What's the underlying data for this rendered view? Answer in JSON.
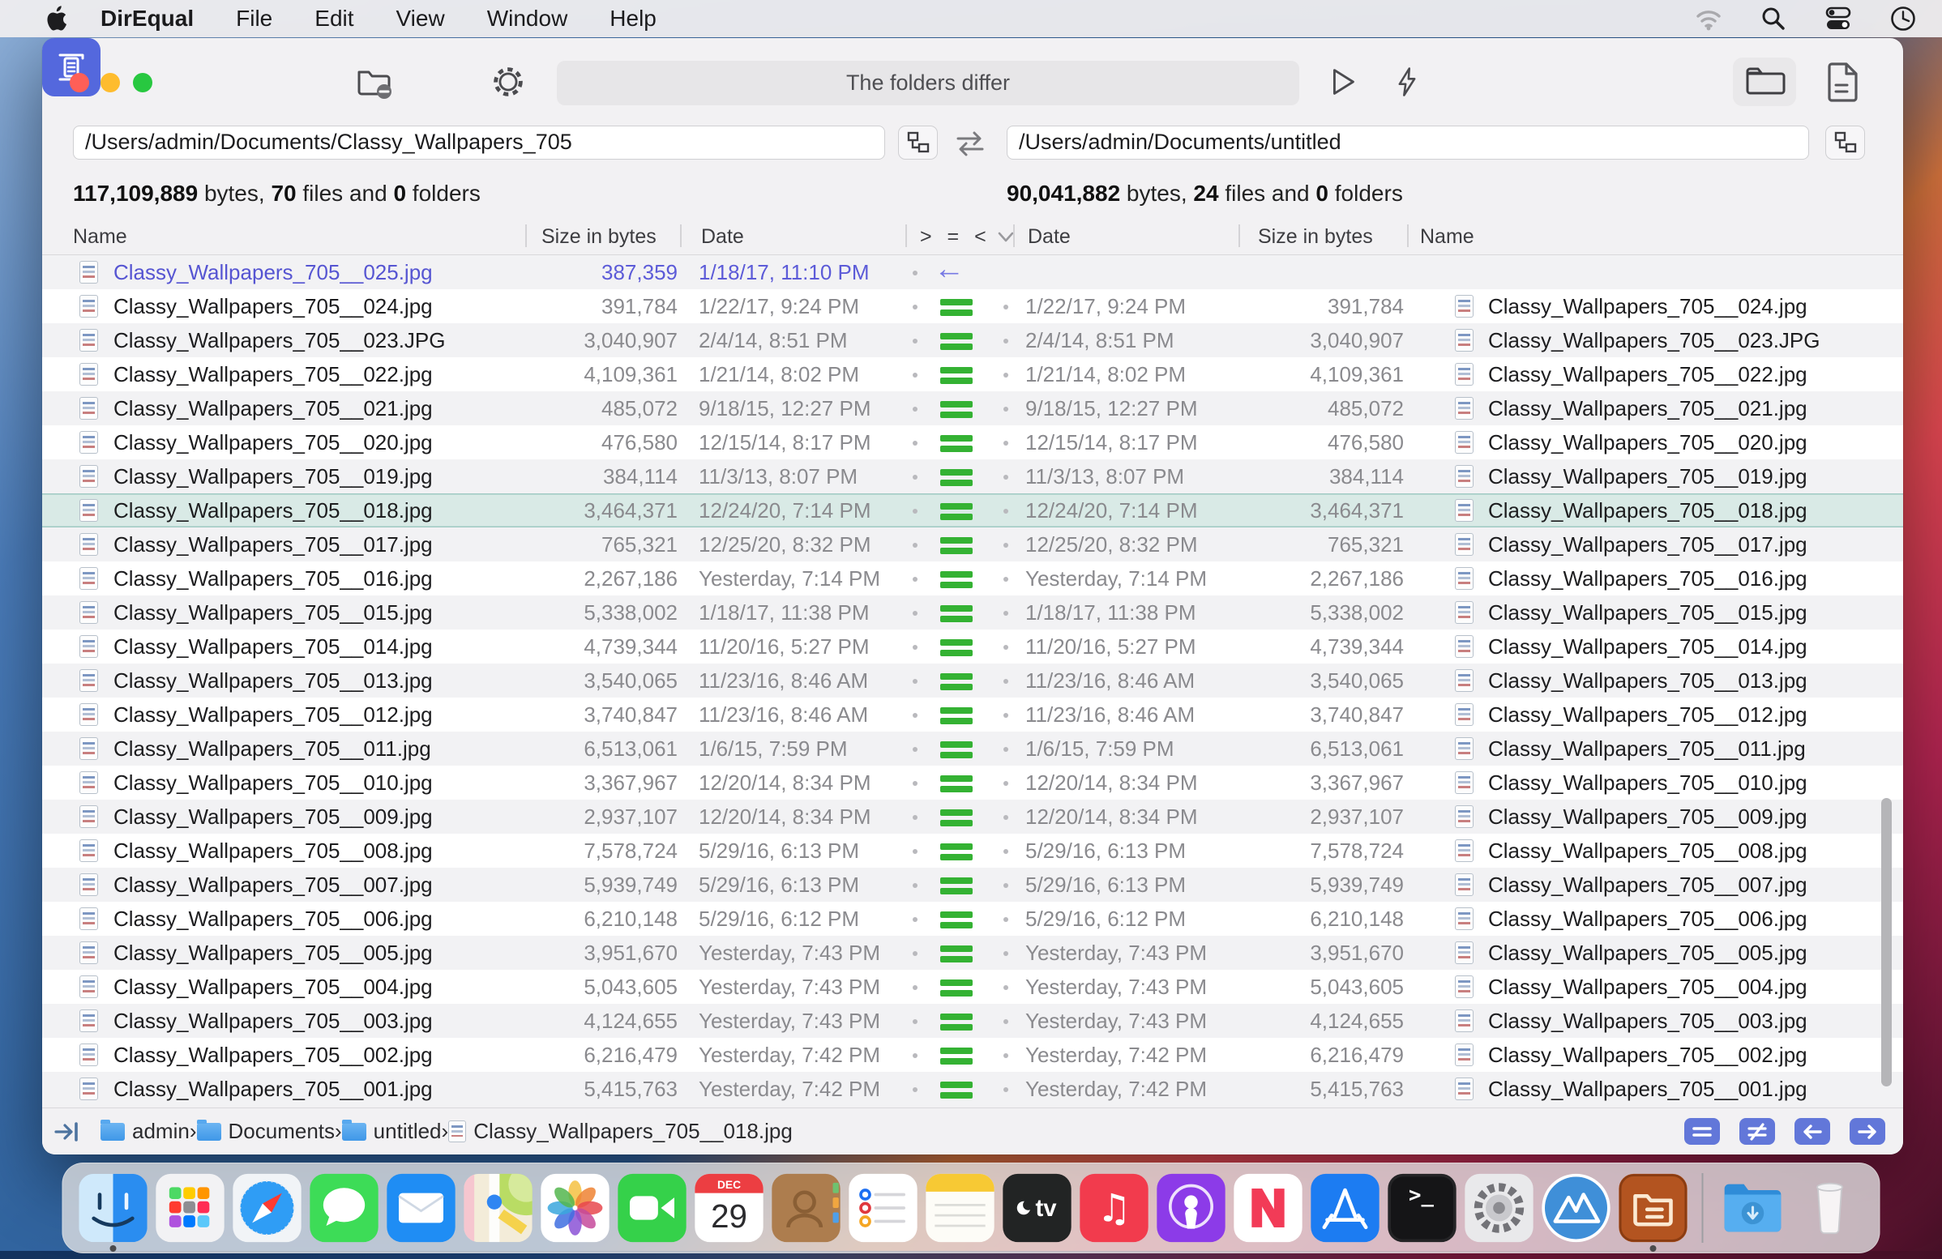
{
  "menu_bar": {
    "app_name": "DirEqual",
    "menus": [
      "File",
      "Edit",
      "View",
      "Window",
      "Help"
    ],
    "status_icons": [
      "wifi-icon",
      "search-icon",
      "control-center-icon",
      "clock-icon"
    ]
  },
  "toolbar": {
    "status_text": "The folders differ"
  },
  "panes": {
    "left": {
      "path": "/Users/admin/Documents/Classy_Wallpapers_705",
      "bytes": "117,109,889",
      "bytes_label": " bytes, ",
      "files": "70",
      "files_label": " files and ",
      "folders": "0",
      "folders_label": " folders"
    },
    "right": {
      "path": "/Users/admin/Documents/untitled",
      "bytes": "90,041,882",
      "bytes_label": " bytes, ",
      "files": "24",
      "files_label": " files and ",
      "folders": "0",
      "folders_label": " folders"
    }
  },
  "table": {
    "headers": {
      "name_left": "Name",
      "size_left": "Size in bytes",
      "date_left": "Date",
      "compare": "> = <",
      "date_right": "Date",
      "size_right": "Size in bytes",
      "name_right": "Name"
    },
    "rows": [
      {
        "left_name": "Classy_Wallpapers_705__025.jpg",
        "left_size": "387,359",
        "left_date": "1/18/17, 11:10 PM",
        "status": "left_only",
        "right_date": "",
        "right_size": "",
        "right_name": "",
        "selected": false
      },
      {
        "left_name": "Classy_Wallpapers_705__024.jpg",
        "left_size": "391,784",
        "left_date": "1/22/17, 9:24 PM",
        "status": "equal",
        "right_date": "1/22/17, 9:24 PM",
        "right_size": "391,784",
        "right_name": "Classy_Wallpapers_705__024.jpg",
        "selected": false
      },
      {
        "left_name": "Classy_Wallpapers_705__023.JPG",
        "left_size": "3,040,907",
        "left_date": "2/4/14, 8:51 PM",
        "status": "equal",
        "right_date": "2/4/14, 8:51 PM",
        "right_size": "3,040,907",
        "right_name": "Classy_Wallpapers_705__023.JPG",
        "selected": false
      },
      {
        "left_name": "Classy_Wallpapers_705__022.jpg",
        "left_size": "4,109,361",
        "left_date": "1/21/14, 8:02 PM",
        "status": "equal",
        "right_date": "1/21/14, 8:02 PM",
        "right_size": "4,109,361",
        "right_name": "Classy_Wallpapers_705__022.jpg",
        "selected": false
      },
      {
        "left_name": "Classy_Wallpapers_705__021.jpg",
        "left_size": "485,072",
        "left_date": "9/18/15, 12:27 PM",
        "status": "equal",
        "right_date": "9/18/15, 12:27 PM",
        "right_size": "485,072",
        "right_name": "Classy_Wallpapers_705__021.jpg",
        "selected": false
      },
      {
        "left_name": "Classy_Wallpapers_705__020.jpg",
        "left_size": "476,580",
        "left_date": "12/15/14, 8:17 PM",
        "status": "equal",
        "right_date": "12/15/14, 8:17 PM",
        "right_size": "476,580",
        "right_name": "Classy_Wallpapers_705__020.jpg",
        "selected": false
      },
      {
        "left_name": "Classy_Wallpapers_705__019.jpg",
        "left_size": "384,114",
        "left_date": "11/3/13, 8:07 PM",
        "status": "equal",
        "right_date": "11/3/13, 8:07 PM",
        "right_size": "384,114",
        "right_name": "Classy_Wallpapers_705__019.jpg",
        "selected": false
      },
      {
        "left_name": "Classy_Wallpapers_705__018.jpg",
        "left_size": "3,464,371",
        "left_date": "12/24/20, 7:14 PM",
        "status": "equal",
        "right_date": "12/24/20, 7:14 PM",
        "right_size": "3,464,371",
        "right_name": "Classy_Wallpapers_705__018.jpg",
        "selected": true
      },
      {
        "left_name": "Classy_Wallpapers_705__017.jpg",
        "left_size": "765,321",
        "left_date": "12/25/20, 8:32 PM",
        "status": "equal",
        "right_date": "12/25/20, 8:32 PM",
        "right_size": "765,321",
        "right_name": "Classy_Wallpapers_705__017.jpg",
        "selected": false
      },
      {
        "left_name": "Classy_Wallpapers_705__016.jpg",
        "left_size": "2,267,186",
        "left_date": "Yesterday, 7:14 PM",
        "status": "equal",
        "right_date": "Yesterday, 7:14 PM",
        "right_size": "2,267,186",
        "right_name": "Classy_Wallpapers_705__016.jpg",
        "selected": false
      },
      {
        "left_name": "Classy_Wallpapers_705__015.jpg",
        "left_size": "5,338,002",
        "left_date": "1/18/17, 11:38 PM",
        "status": "equal",
        "right_date": "1/18/17, 11:38 PM",
        "right_size": "5,338,002",
        "right_name": "Classy_Wallpapers_705__015.jpg",
        "selected": false
      },
      {
        "left_name": "Classy_Wallpapers_705__014.jpg",
        "left_size": "4,739,344",
        "left_date": "11/20/16, 5:27 PM",
        "status": "equal",
        "right_date": "11/20/16, 5:27 PM",
        "right_size": "4,739,344",
        "right_name": "Classy_Wallpapers_705__014.jpg",
        "selected": false
      },
      {
        "left_name": "Classy_Wallpapers_705__013.jpg",
        "left_size": "3,540,065",
        "left_date": "11/23/16, 8:46 AM",
        "status": "equal",
        "right_date": "11/23/16, 8:46 AM",
        "right_size": "3,540,065",
        "right_name": "Classy_Wallpapers_705__013.jpg",
        "selected": false
      },
      {
        "left_name": "Classy_Wallpapers_705__012.jpg",
        "left_size": "3,740,847",
        "left_date": "11/23/16, 8:46 AM",
        "status": "equal",
        "right_date": "11/23/16, 8:46 AM",
        "right_size": "3,740,847",
        "right_name": "Classy_Wallpapers_705__012.jpg",
        "selected": false
      },
      {
        "left_name": "Classy_Wallpapers_705__011.jpg",
        "left_size": "6,513,061",
        "left_date": "1/6/15, 7:59 PM",
        "status": "equal",
        "right_date": "1/6/15, 7:59 PM",
        "right_size": "6,513,061",
        "right_name": "Classy_Wallpapers_705__011.jpg",
        "selected": false
      },
      {
        "left_name": "Classy_Wallpapers_705__010.jpg",
        "left_size": "3,367,967",
        "left_date": "12/20/14, 8:34 PM",
        "status": "equal",
        "right_date": "12/20/14, 8:34 PM",
        "right_size": "3,367,967",
        "right_name": "Classy_Wallpapers_705__010.jpg",
        "selected": false
      },
      {
        "left_name": "Classy_Wallpapers_705__009.jpg",
        "left_size": "2,937,107",
        "left_date": "12/20/14, 8:34 PM",
        "status": "equal",
        "right_date": "12/20/14, 8:34 PM",
        "right_size": "2,937,107",
        "right_name": "Classy_Wallpapers_705__009.jpg",
        "selected": false
      },
      {
        "left_name": "Classy_Wallpapers_705__008.jpg",
        "left_size": "7,578,724",
        "left_date": "5/29/16, 6:13 PM",
        "status": "equal",
        "right_date": "5/29/16, 6:13 PM",
        "right_size": "7,578,724",
        "right_name": "Classy_Wallpapers_705__008.jpg",
        "selected": false
      },
      {
        "left_name": "Classy_Wallpapers_705__007.jpg",
        "left_size": "5,939,749",
        "left_date": "5/29/16, 6:13 PM",
        "status": "equal",
        "right_date": "5/29/16, 6:13 PM",
        "right_size": "5,939,749",
        "right_name": "Classy_Wallpapers_705__007.jpg",
        "selected": false
      },
      {
        "left_name": "Classy_Wallpapers_705__006.jpg",
        "left_size": "6,210,148",
        "left_date": "5/29/16, 6:12 PM",
        "status": "equal",
        "right_date": "5/29/16, 6:12 PM",
        "right_size": "6,210,148",
        "right_name": "Classy_Wallpapers_705__006.jpg",
        "selected": false
      },
      {
        "left_name": "Classy_Wallpapers_705__005.jpg",
        "left_size": "3,951,670",
        "left_date": "Yesterday, 7:43 PM",
        "status": "equal",
        "right_date": "Yesterday, 7:43 PM",
        "right_size": "3,951,670",
        "right_name": "Classy_Wallpapers_705__005.jpg",
        "selected": false
      },
      {
        "left_name": "Classy_Wallpapers_705__004.jpg",
        "left_size": "5,043,605",
        "left_date": "Yesterday, 7:43 PM",
        "status": "equal",
        "right_date": "Yesterday, 7:43 PM",
        "right_size": "5,043,605",
        "right_name": "Classy_Wallpapers_705__004.jpg",
        "selected": false
      },
      {
        "left_name": "Classy_Wallpapers_705__003.jpg",
        "left_size": "4,124,655",
        "left_date": "Yesterday, 7:43 PM",
        "status": "equal",
        "right_date": "Yesterday, 7:43 PM",
        "right_size": "4,124,655",
        "right_name": "Classy_Wallpapers_705__003.jpg",
        "selected": false
      },
      {
        "left_name": "Classy_Wallpapers_705__002.jpg",
        "left_size": "6,216,479",
        "left_date": "Yesterday, 7:42 PM",
        "status": "equal",
        "right_date": "Yesterday, 7:42 PM",
        "right_size": "6,216,479",
        "right_name": "Classy_Wallpapers_705__002.jpg",
        "selected": false
      },
      {
        "left_name": "Classy_Wallpapers_705__001.jpg",
        "left_size": "5,415,763",
        "left_date": "Yesterday, 7:42 PM",
        "status": "equal",
        "right_date": "Yesterday, 7:42 PM",
        "right_size": "5,415,763",
        "right_name": "Classy_Wallpapers_705__001.jpg",
        "selected": false
      }
    ]
  },
  "statusbar": {
    "breadcrumbs": [
      {
        "label": "admin",
        "icon": "folder"
      },
      {
        "label": "Documents",
        "icon": "folder"
      },
      {
        "label": "untitled",
        "icon": "folder"
      },
      {
        "label": "Classy_Wallpapers_705__018.jpg",
        "icon": "file"
      }
    ],
    "separator": "›",
    "filter_buttons": [
      "equal",
      "not-equal",
      "arrow-left",
      "arrow-right"
    ]
  },
  "dock": {
    "items": [
      "finder",
      "launchpad",
      "safari",
      "messages",
      "mail",
      "maps",
      "photos",
      "facetime",
      "calendar",
      "contacts",
      "reminders",
      "notes",
      "tv",
      "music",
      "podcasts",
      "news",
      "appstore",
      "terminal",
      "settings",
      "mountain-app",
      "direqual",
      "separator",
      "downloads",
      "trash"
    ],
    "running": [
      "finder",
      "direqual"
    ],
    "calendar_month": "DEC",
    "calendar_day": "29"
  },
  "colors": {
    "accent_blue": "#5468dd",
    "equal_green": "#34b233",
    "left_only_purple": "#5c5bd8",
    "selected_row": "#d9eae6",
    "filter_button_blue": "#6277d9"
  }
}
